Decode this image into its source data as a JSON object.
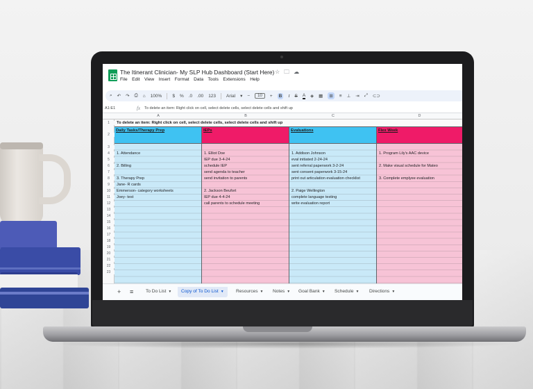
{
  "window": {
    "doc_title": "The Itinerant Clinician- My SLP Hub Dashboard (Start Here)",
    "title_icons": [
      "star-icon",
      "folder-icon",
      "cloud-icon"
    ]
  },
  "menu": [
    "File",
    "Edit",
    "View",
    "Insert",
    "Format",
    "Data",
    "Tools",
    "Extensions",
    "Help"
  ],
  "toolbar": {
    "zoom": "100%",
    "currency": "$",
    "percent": "%",
    "decimal_dec": ".0",
    "decimal_inc": ".00",
    "number_format": "123",
    "font": "Arial",
    "font_size": "10",
    "bold": "B",
    "italic": "I",
    "strike": "S",
    "text_color": "A"
  },
  "formula_bar": {
    "cell_ref": "A1:E1",
    "fx": "fx",
    "content": "To delete an item: Right click on cell, select delete cells, select delete cells and shift up"
  },
  "grid": {
    "column_letters": [
      "A",
      "B",
      "C",
      "D"
    ],
    "row_numbers": [
      "1",
      "2",
      "3",
      "4",
      "5",
      "6",
      "7",
      "8",
      "9",
      "10",
      "11",
      "12",
      "13",
      "14",
      "15",
      "16",
      "17",
      "18",
      "19",
      "20",
      "21",
      "22",
      "23"
    ],
    "row1_text": "To delete an item: Right click on cell, select delete cells, select delete cells and shift up",
    "headers": {
      "a": "Daily Tasks/Therapy Prep",
      "b": "IEPs",
      "c": "Evaluations",
      "d": "Flex Week"
    },
    "col_a": {
      "r4": "1. Attendance",
      "r6": "2. Billing",
      "r8": "3. Therapy Prep",
      "r9": "Jane- R cards",
      "r10": "Emmerson- category worksheets",
      "r11": "Joey- test"
    },
    "col_b": {
      "r4": "1. Elliot Doe",
      "r5": "IEP due 3-4-24",
      "r6": "schedule IEP",
      "r7": "send agenda to teacher",
      "r8": "send invitation to parents",
      "r10": "2. Jackson Beufort",
      "r11": "IEP due 4-4-24",
      "r12": "call parents to schedule meeting"
    },
    "col_c": {
      "r4": "1. Addison Johnson",
      "r5": "eval initiated 2-24-24",
      "r6": "sent referral paperwork 3-2-24",
      "r7": "sent consent paperwork 3-15-24",
      "r8": "print out articulation evaluation checklist",
      "r10": "2. Paige Wellington",
      "r11": "complete language testing",
      "r12": "write evaluation report"
    },
    "col_d": {
      "r4": "1. Program Lily's AAC device",
      "r6": "2. Make visual schedule for Mateo",
      "r8": "3. Complete emplyee evaluation"
    }
  },
  "sheet_tabs": {
    "add": "+",
    "all_sheets": "≡",
    "tabs": [
      "To Do List",
      "Copy of To Do List",
      "Resources",
      "Notes",
      "Goal Bank",
      "Schedule",
      "Directions"
    ],
    "active_index": 1
  },
  "colors": {
    "header_blue": "#3fc2f2",
    "header_pink": "#ef1b68",
    "column_blue": "#c9e9f8",
    "column_pink": "#f7c3d6",
    "sheets_green": "#0f9d58"
  }
}
